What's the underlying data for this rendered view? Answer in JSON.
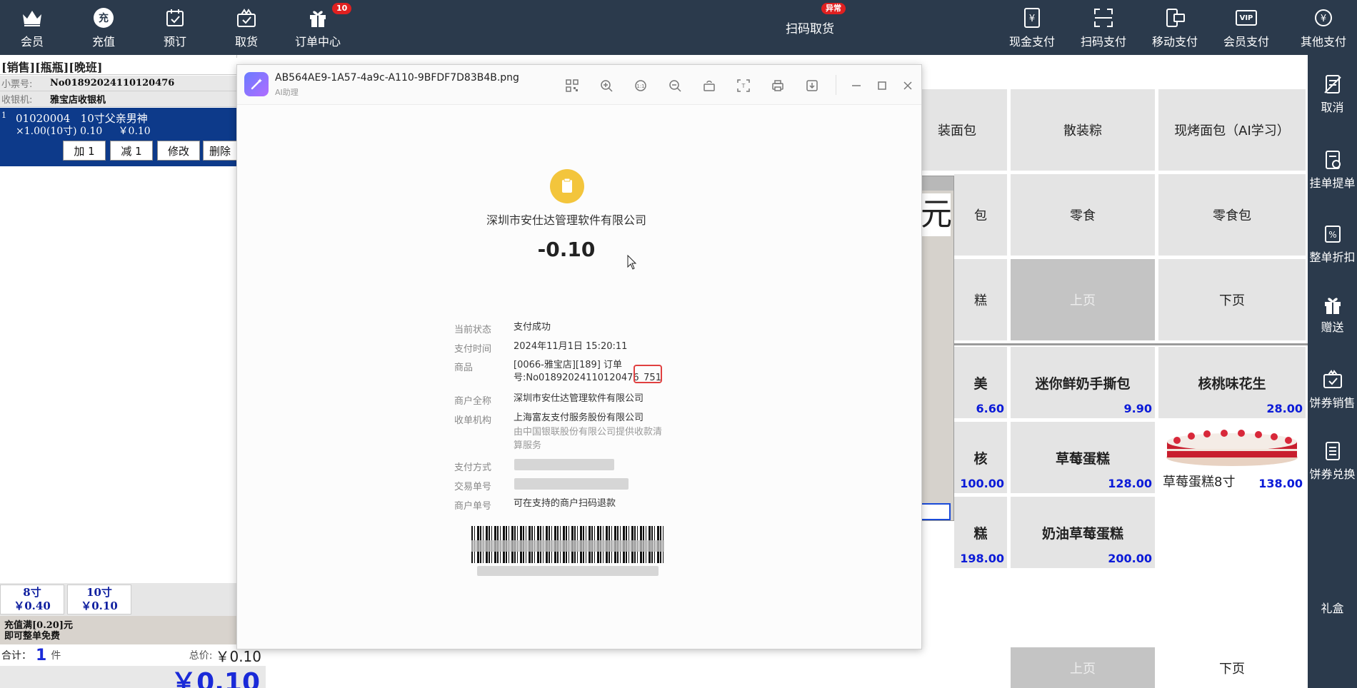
{
  "topbar": {
    "left_buttons": [
      {
        "label": "会员",
        "icon": "crown-icon"
      },
      {
        "label": "充值",
        "icon": "recharge-icon",
        "icon_text": "充"
      },
      {
        "label": "预订",
        "icon": "calendar-check-icon"
      },
      {
        "label": "取货",
        "icon": "gift-box-check-icon"
      },
      {
        "label": "订单中心",
        "icon": "gift-icon",
        "badge": "10"
      }
    ],
    "center": {
      "label": "扫码取货",
      "badge": "异常"
    },
    "right_buttons": [
      {
        "label": "现金支付",
        "icon": "cash-yen-icon"
      },
      {
        "label": "扫码支付",
        "icon": "scan-frame-icon"
      },
      {
        "label": "移动支付",
        "icon": "mobile-pay-icon"
      },
      {
        "label": "会员支付",
        "icon": "vip-card-icon",
        "icon_text": "VIP"
      },
      {
        "label": "其他支付",
        "icon": "coin-yen-icon"
      }
    ]
  },
  "right_sidebar": [
    {
      "label": "取消",
      "icon": "cancel-doc-icon"
    },
    {
      "label": "挂单提单",
      "icon": "hold-order-icon"
    },
    {
      "label": "整单折扣",
      "icon": "discount-icon"
    },
    {
      "label": "赠送",
      "icon": "gift-icon"
    },
    {
      "label": "饼券销售",
      "icon": "coupon-sale-icon"
    },
    {
      "label": "饼券兑换",
      "icon": "coupon-redeem-icon"
    },
    {
      "label": "礼盒",
      "icon": ""
    }
  ],
  "left_panel": {
    "title": "[销售][瓶瓶][晚班]",
    "ticket_label": "小票号:",
    "ticket_value": "No018920241101204​76",
    "cashier_label": "收银机:",
    "cashier_value": "雅宝店收银机",
    "item": {
      "index": "1",
      "code": "01020004",
      "name": "10寸父亲男神",
      "qty_line": "×1.00(10寸)",
      "unit_price": "0.10",
      "amount": "￥0.10"
    },
    "actions": [
      "加 1",
      "减 1",
      "修改",
      "删除"
    ],
    "sizes": [
      {
        "name": "8寸",
        "price": "￥0.40"
      },
      {
        "name": "10寸",
        "price": "￥0.10"
      }
    ],
    "promo_line1": "充值满[0.20]元",
    "promo_line2": "即可整单免费",
    "total_label": "合计：",
    "total_count": "1",
    "total_unit": "件",
    "total_price_label": "总价:",
    "total_price": "￥0.10",
    "pay_amount": "￥0.10"
  },
  "products": {
    "row1": [
      "装面包",
      "散装粽",
      "现烤面包（AI学习）"
    ],
    "row2": [
      "包",
      "零食",
      "零食包"
    ],
    "row3": [
      "糕",
      "上页",
      "下页"
    ],
    "row4": [
      {
        "name": "美",
        "price": "6.60"
      },
      {
        "name": "迷你鲜奶手撕包",
        "price": "9.90"
      },
      {
        "name": "核桃味花生",
        "price": "28.00"
      }
    ],
    "row5": [
      {
        "name": "核",
        "price": "100.00"
      },
      {
        "name": "草莓蛋糕",
        "price": "128.00"
      },
      {
        "name": "草莓蛋糕8寸",
        "price": "138.00"
      }
    ],
    "row6": [
      {
        "name": "糕",
        "price": "198.00"
      },
      {
        "name": "奶油草莓蛋糕",
        "price": "200.00"
      }
    ],
    "bottom_prev": "上页",
    "bottom_next": "下页",
    "dialog_partial": "元"
  },
  "viewer": {
    "file_name": "AB564AE9-1A57-4a9c-A110-9BFDF7D83B4B.png",
    "subtitle": "AI助理",
    "tools": [
      "qr-code-icon",
      "zoom-in-icon",
      "actual-size-icon",
      "zoom-out-icon",
      "rotate-icon",
      "crop-icon",
      "print-icon",
      "download-icon"
    ],
    "receipt": {
      "company": "深圳市安仕达管理软件有限公司",
      "amount": "-0.10",
      "fields": [
        {
          "k": "当前状态",
          "v": "支付成功"
        },
        {
          "k": "支付时间",
          "v": "2024年11月1日 15:20:11"
        },
        {
          "k": "商品",
          "v": "[0066-雅宝店][189] 订单",
          "v2": "号:No018920241101204​76_751"
        },
        {
          "k": "商户全称",
          "v": "深圳市安仕达管理软件有限公司"
        },
        {
          "k": "收单机构",
          "v": "上海富友支付服务股份有限公司",
          "v2": "由中国银联股份有限公司提供收款清",
          "v3": "算服务"
        },
        {
          "k": "支付方式",
          "v": ""
        },
        {
          "k": "交易单号",
          "v": ""
        },
        {
          "k": "商户单号",
          "v": "可在支持的商户扫码退款"
        }
      ]
    }
  }
}
